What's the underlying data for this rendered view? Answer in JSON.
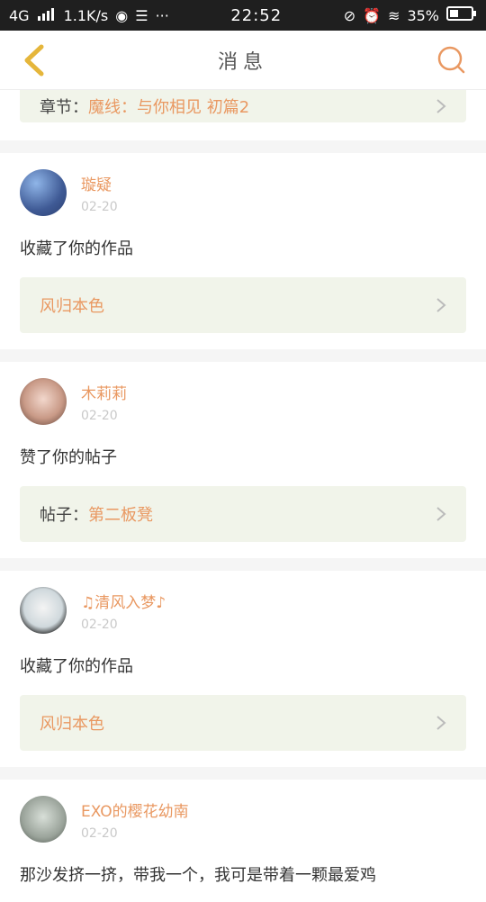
{
  "status": {
    "network": "4G",
    "speed": "1.1K/s",
    "more": "···",
    "time": "22:52",
    "battery": "35%"
  },
  "nav": {
    "title": "消息"
  },
  "top_partial": {
    "prefix": "章节：",
    "value": "魔线：与你相见 初篇2"
  },
  "messages": [
    {
      "username": "璇疑",
      "date": "02-20",
      "action": "收藏了你的作品",
      "ref_prefix": "",
      "ref_value": "风归本色"
    },
    {
      "username": "木莉莉",
      "date": "02-20",
      "action": "赞了你的帖子",
      "ref_prefix": "帖子：",
      "ref_value": "第二板凳"
    },
    {
      "username": "♫清风入梦♪",
      "date": "02-20",
      "action": "收藏了你的作品",
      "ref_prefix": "",
      "ref_value": "风归本色"
    },
    {
      "username": "EXO的樱花幼南",
      "date": "02-20",
      "action": "那沙发挤一挤，带我一个，我可是带着一颗最爱鸡",
      "ref_prefix": "",
      "ref_value": ""
    }
  ],
  "colors": {
    "accent": "#e99861",
    "ref_bg": "#f1f4ea",
    "back": "#e5b63b"
  }
}
